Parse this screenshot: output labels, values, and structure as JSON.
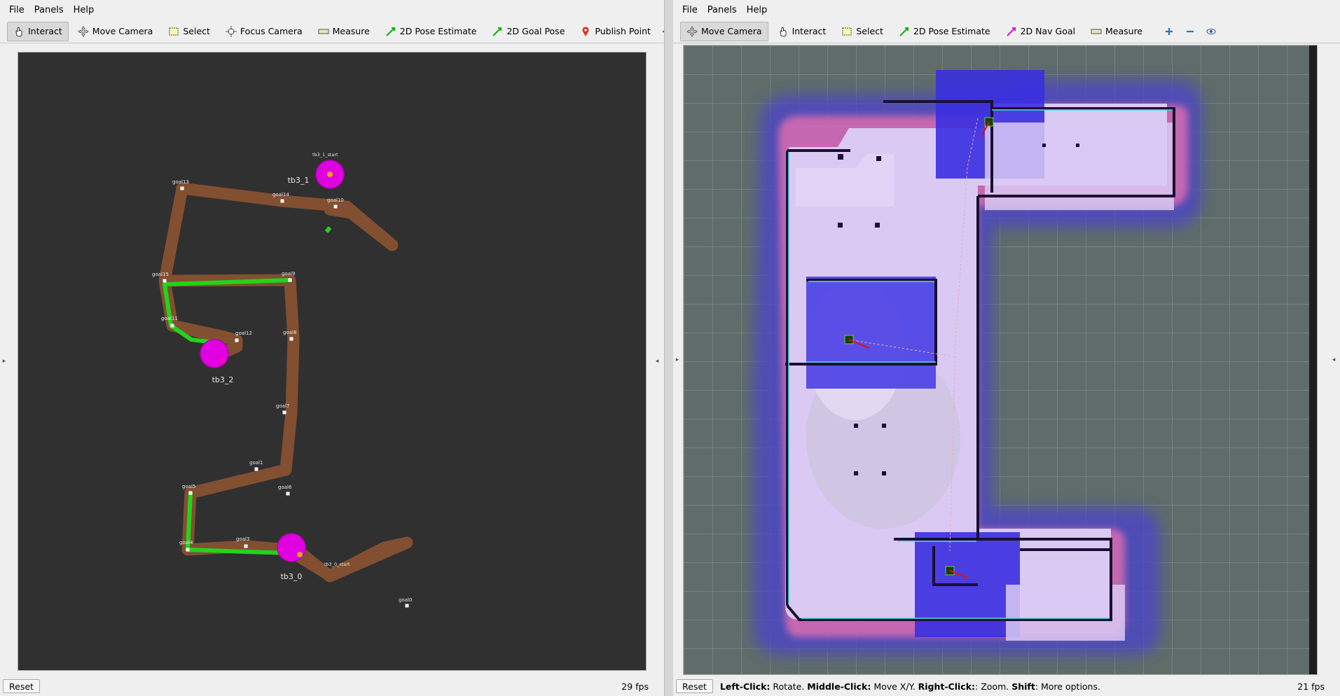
{
  "left_window": {
    "menu": [
      "File",
      "Panels",
      "Help"
    ],
    "tools": [
      "Interact",
      "Move Camera",
      "Select",
      "Focus Camera",
      "Measure",
      "2D Pose Estimate",
      "2D Goal Pose",
      "Publish Point"
    ],
    "active_tool": "Interact",
    "overflow_icon": "chevron-double-right-icon",
    "reset_label": "Reset",
    "fps": "29 fps",
    "robots": [
      {
        "name": "tb3_0",
        "start_label": "tb3_0_start"
      },
      {
        "name": "tb3_1",
        "start_label": "tb3_1_start"
      },
      {
        "name": "tb3_2"
      }
    ],
    "goals": [
      "goal0",
      "goal1",
      "goal3",
      "goal4",
      "goal5",
      "goal6",
      "goal7",
      "goal8",
      "goal9",
      "goal10",
      "goal11",
      "goal12",
      "goal13",
      "goal14",
      "goal15"
    ],
    "colors": {
      "background": "#303030",
      "path": "#8a5232",
      "active_path": "#22d41a",
      "robot": "#e000e0"
    }
  },
  "right_window": {
    "menu": [
      "File",
      "Panels",
      "Help"
    ],
    "tools": [
      "Move Camera",
      "Interact",
      "Select",
      "2D Pose Estimate",
      "2D Nav Goal",
      "Measure"
    ],
    "active_tool": "Move Camera",
    "extra_icons": [
      "zoom-plus-icon",
      "zoom-minus-icon",
      "eye-icon"
    ],
    "reset_label": "Reset",
    "hint": {
      "left_key": "Left-Click:",
      "left_text": " Rotate. ",
      "middle_key": "Middle-Click:",
      "middle_text": " Move X/Y. ",
      "right_key": "Right-Click:",
      "right_text": ": Zoom. ",
      "shift_key": "Shift",
      "shift_text": ": More options."
    },
    "fps": "21 fps",
    "colors": {
      "background": "#5f6c6a",
      "free": "#d9c9f3",
      "costmap": "#3a2fe0",
      "obstacle": "#1a1030"
    }
  }
}
